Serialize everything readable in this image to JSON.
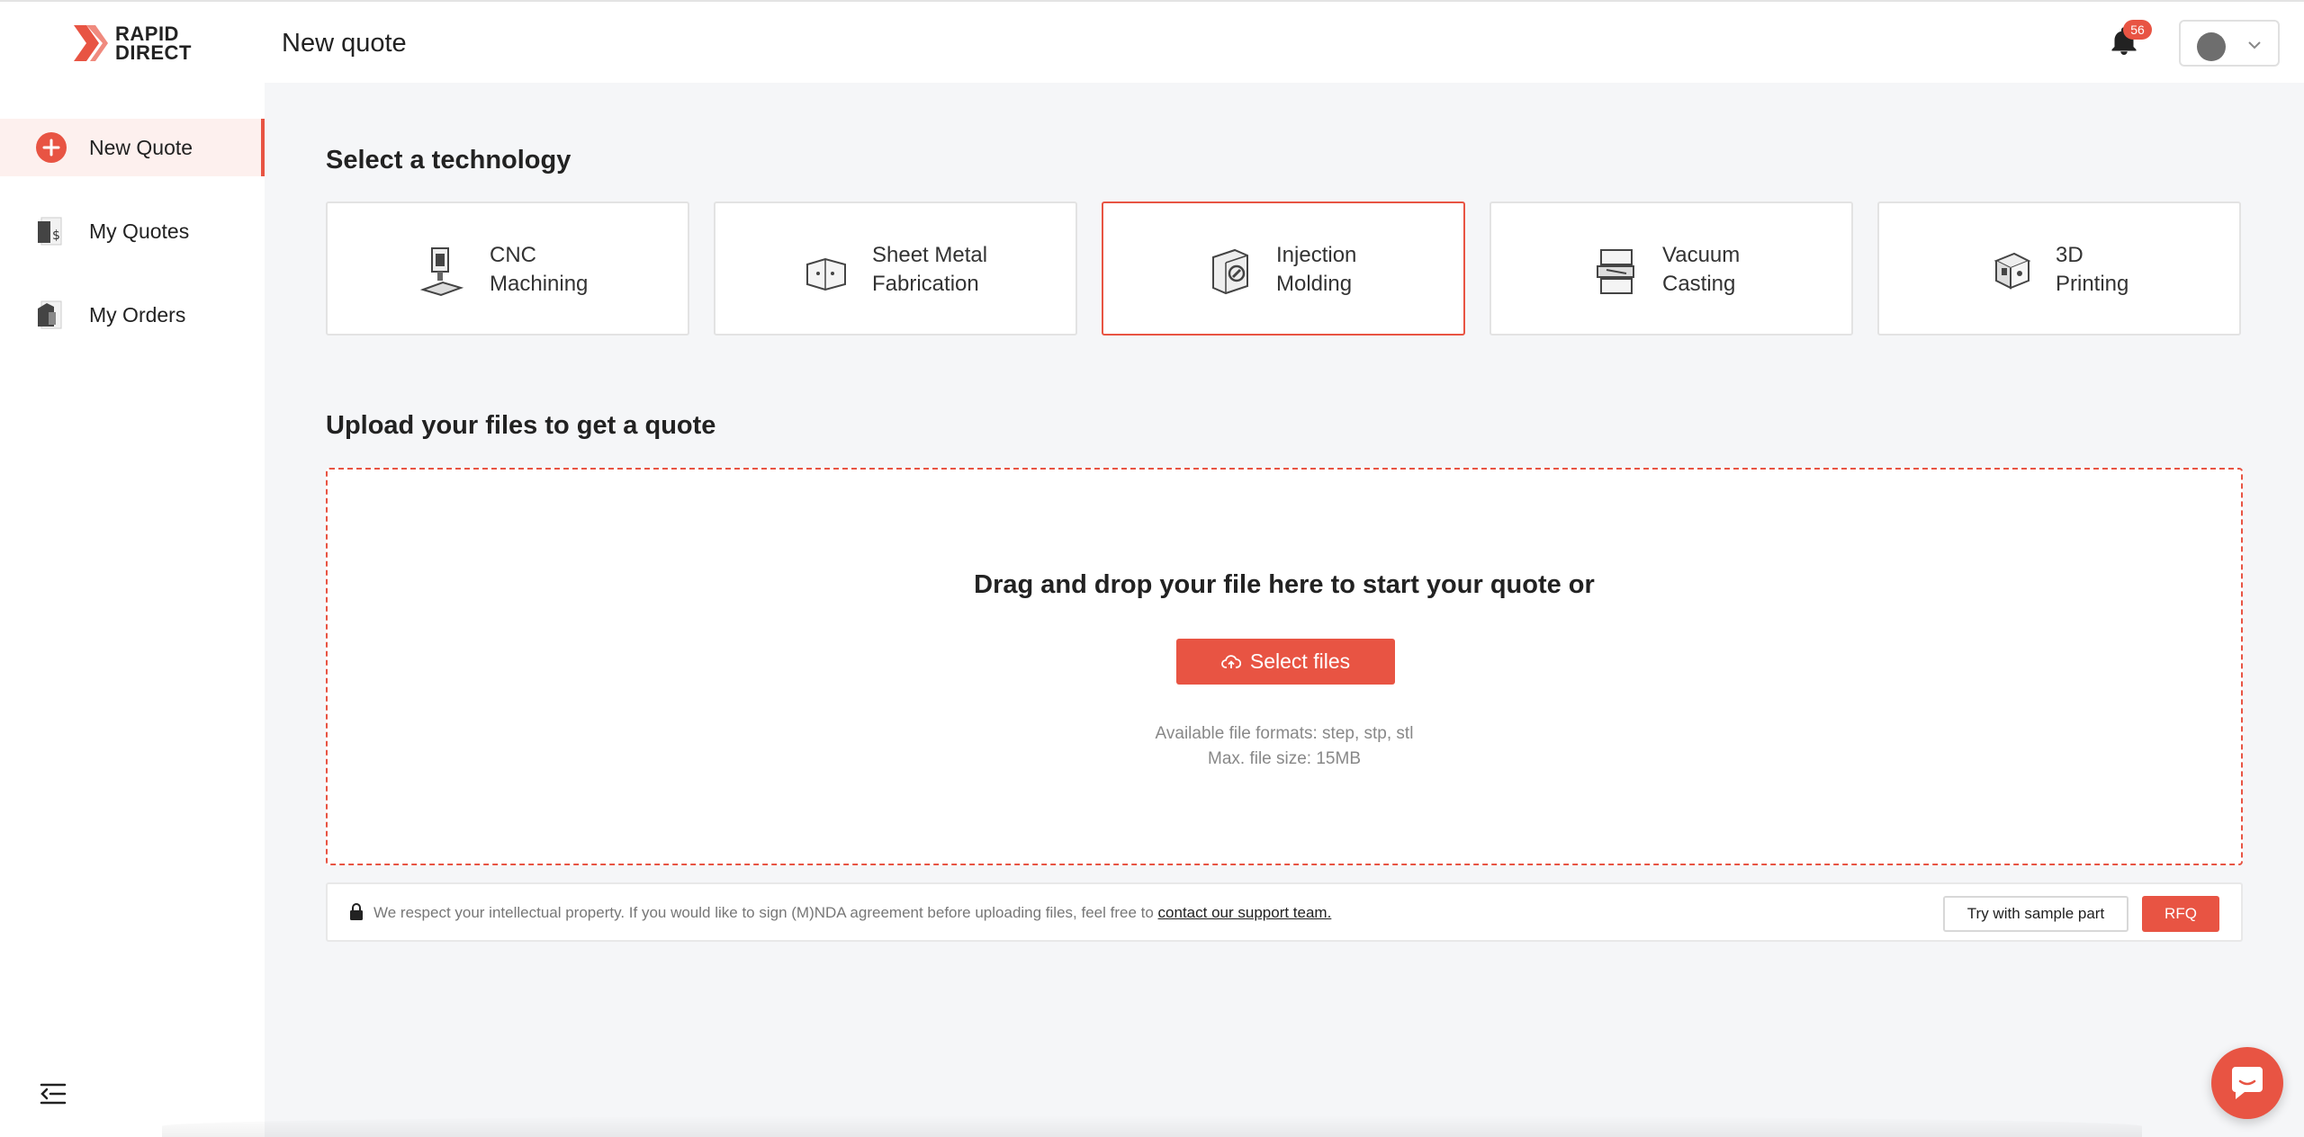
{
  "header": {
    "logo_line1": "RAPID",
    "logo_line2": "DIRECT",
    "title": "New quote",
    "notification_count": "56"
  },
  "sidebar": {
    "items": [
      {
        "label": "New Quote",
        "icon": "plus-circle-icon",
        "active": true
      },
      {
        "label": "My Quotes",
        "icon": "quotes-icon",
        "active": false
      },
      {
        "label": "My Orders",
        "icon": "orders-icon",
        "active": false
      }
    ]
  },
  "technology": {
    "title": "Select a technology",
    "options": [
      {
        "line1": "CNC",
        "line2": "Machining",
        "icon": "cnc-icon"
      },
      {
        "line1": "Sheet Metal",
        "line2": "Fabrication",
        "icon": "sheet-metal-icon"
      },
      {
        "line1": "Injection",
        "line2": "Molding",
        "icon": "injection-molding-icon",
        "selected": true
      },
      {
        "line1": "Vacuum",
        "line2": "Casting",
        "icon": "vacuum-casting-icon"
      },
      {
        "line1": "3D",
        "line2": "Printing",
        "icon": "3d-printing-icon"
      }
    ]
  },
  "upload": {
    "title": "Upload your files to get a quote",
    "drop_text": "Drag and drop your file here to start your quote or",
    "button_label": "Select files",
    "formats": "Available file formats: step, stp, stl",
    "max_size": "Max. file size: 15MB"
  },
  "ip_notice": {
    "text": "We respect your intellectual property. If you would like to sign (M)NDA agreement before uploading files, feel free to ",
    "link": "contact our support team.",
    "sample_button": "Try with sample part",
    "rfq_button": "RFQ"
  },
  "colors": {
    "accent": "#e85443",
    "background": "#f5f6f8"
  }
}
